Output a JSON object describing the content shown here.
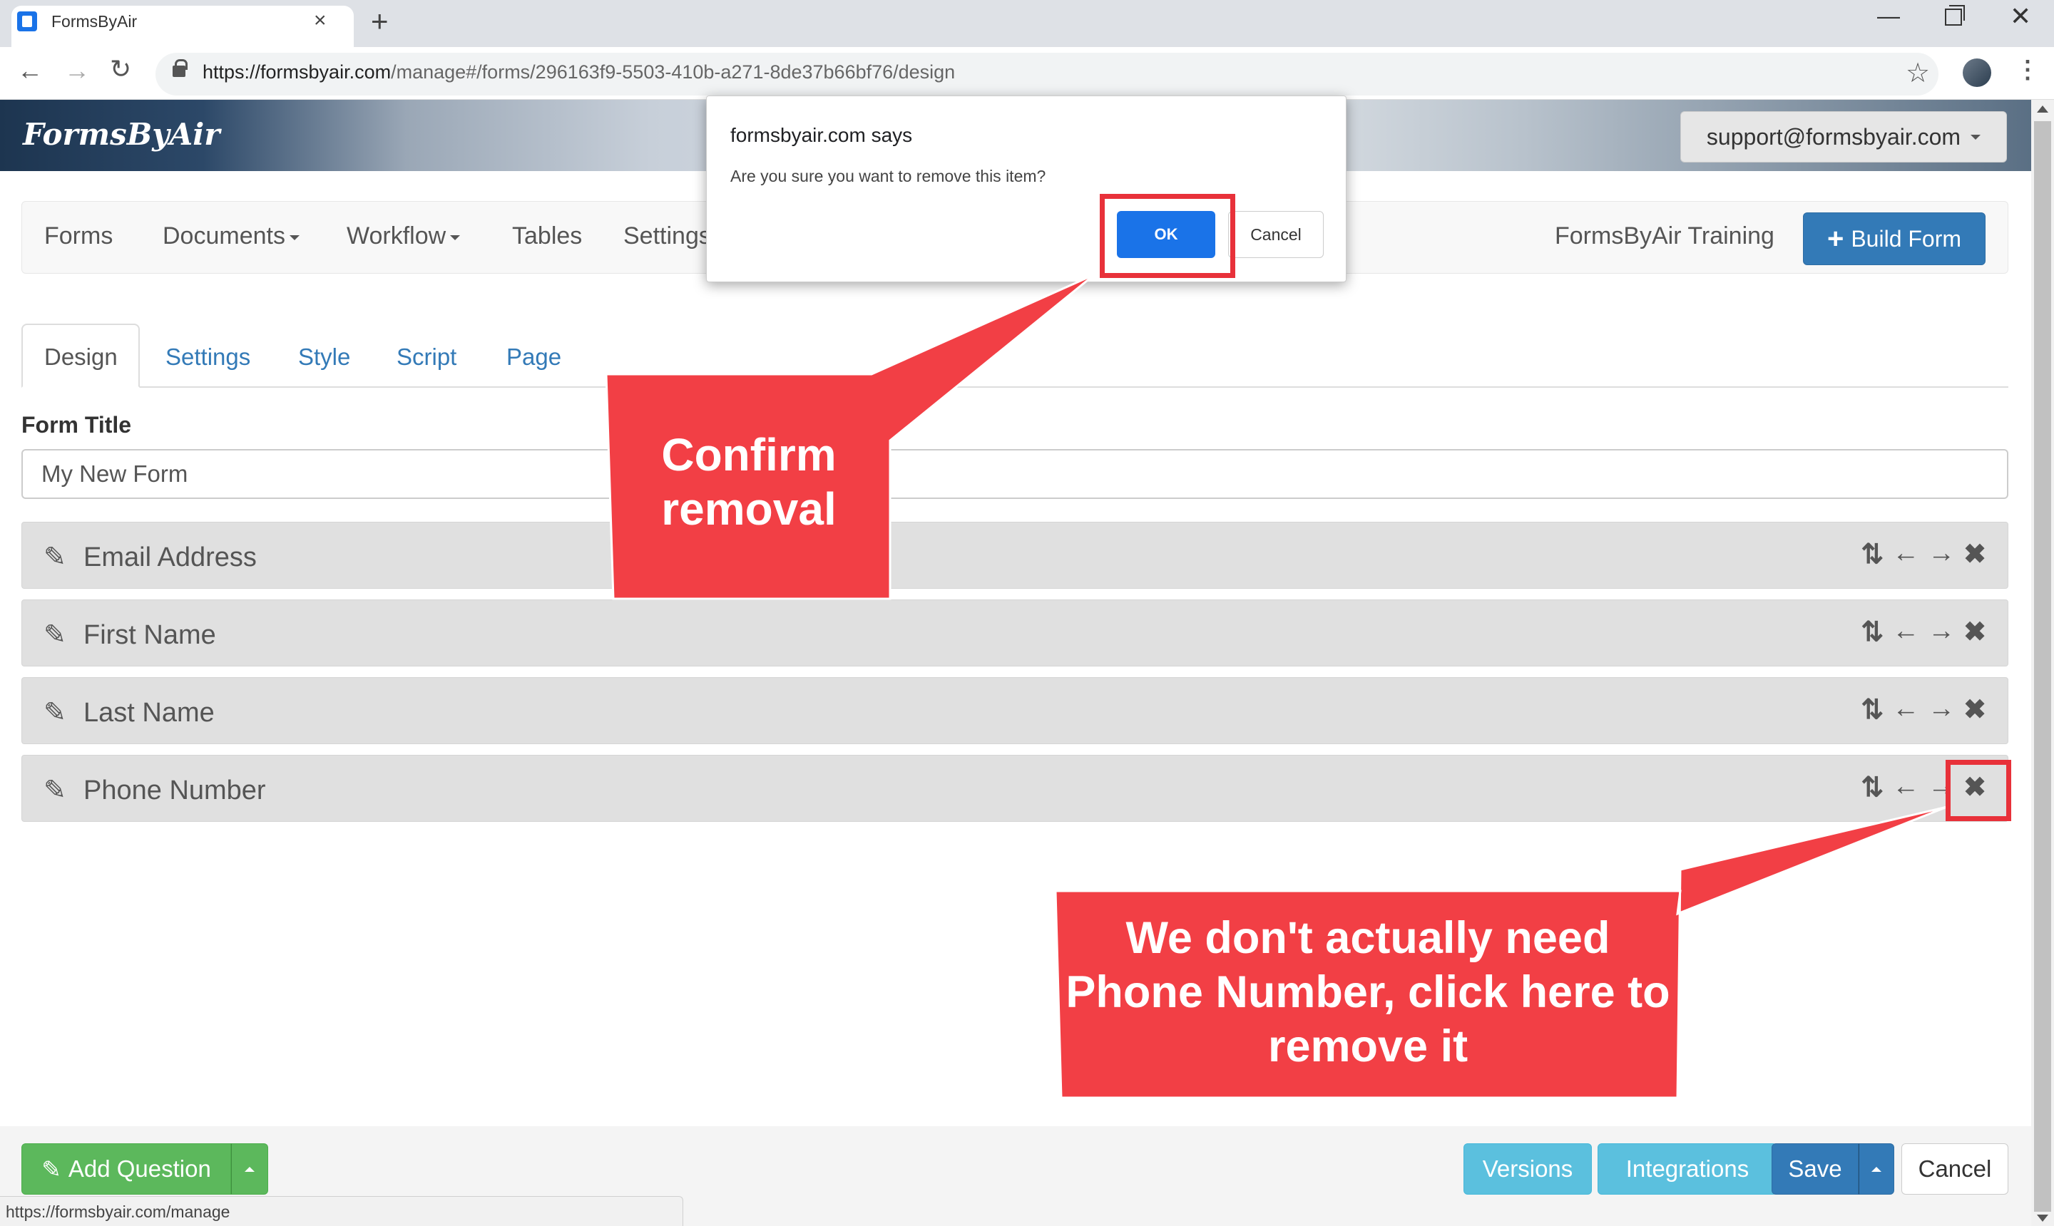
{
  "browser": {
    "tab_title": "FormsByAir",
    "url_host": "https://formsbyair.com",
    "url_path": "/manage#/forms/296163f9-5503-410b-a271-8de37b66bf76/design",
    "status_url": "https://formsbyair.com/manage"
  },
  "header": {
    "brand": "FormsByAir",
    "support_email": "support@formsbyair.com"
  },
  "navbar": {
    "items": [
      "Forms",
      "Documents",
      "Workflow",
      "Tables",
      "Settings"
    ],
    "org_name": "FormsByAir Training",
    "build_form_label": "Build Form"
  },
  "form_tabs": [
    "Design",
    "Settings",
    "Style",
    "Script",
    "Page"
  ],
  "form": {
    "title_label": "Form Title",
    "title_value": "My New Form",
    "questions": [
      "Email Address",
      "First Name",
      "Last Name",
      "Phone Number"
    ]
  },
  "footer": {
    "add_question_label": "Add Question",
    "versions_label": "Versions",
    "integrations_label": "Integrations",
    "save_label": "Save",
    "cancel_label": "Cancel"
  },
  "dialog": {
    "title": "formsbyair.com says",
    "message": "Are you sure you want to remove this item?",
    "ok_label": "OK",
    "cancel_label": "Cancel"
  },
  "annotations": {
    "callout_confirm": "Confirm removal",
    "callout_remove": "We don't actually need Phone Number, click here to remove it",
    "callout_color": "#f23f45",
    "highlight_color": "#e8313a"
  },
  "icons": [
    "pencil-icon",
    "sort-icon",
    "arrow-left-icon",
    "arrow-right-icon",
    "remove-icon",
    "plus-icon",
    "lock-icon",
    "star-icon"
  ]
}
